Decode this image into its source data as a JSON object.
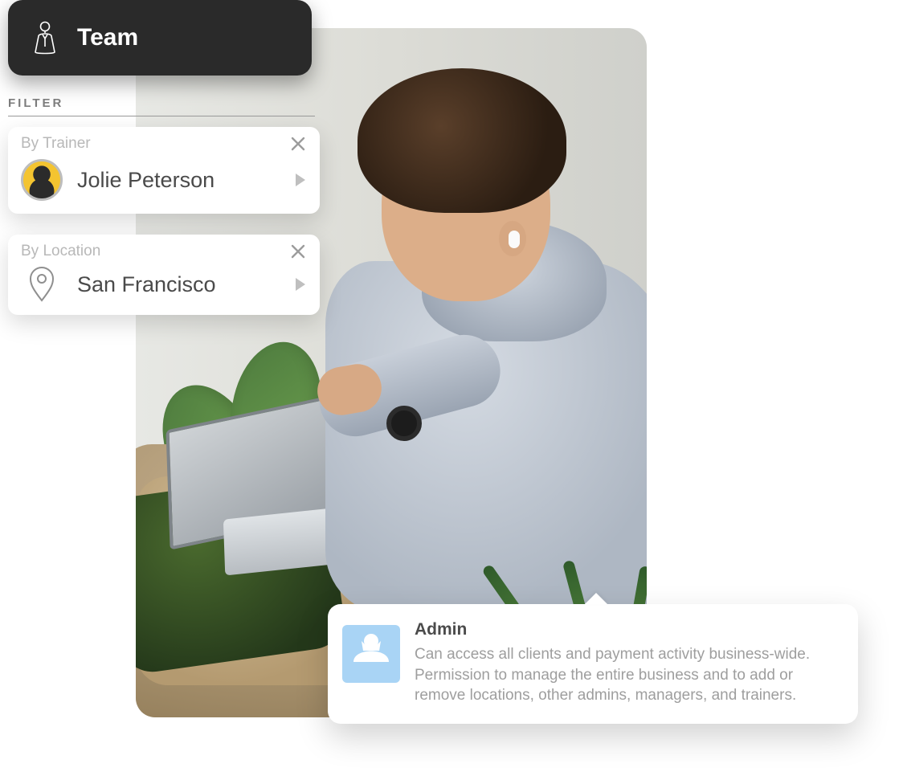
{
  "nav": {
    "team_label": "Team"
  },
  "filter": {
    "section_label": "FILTER",
    "trainer": {
      "label": "By Trainer",
      "value": "Jolie Peterson"
    },
    "location": {
      "label": "By Location",
      "value": "San Francisco"
    }
  },
  "tooltip": {
    "title": "Admin",
    "description": "Can access all clients and payment activity business-wide. Permission to manage the entire business and to add or remove locations, other admins, managers, and trainers."
  },
  "colors": {
    "accent_blue": "#a9d4f5",
    "dark_tab": "#2a2a2a"
  }
}
